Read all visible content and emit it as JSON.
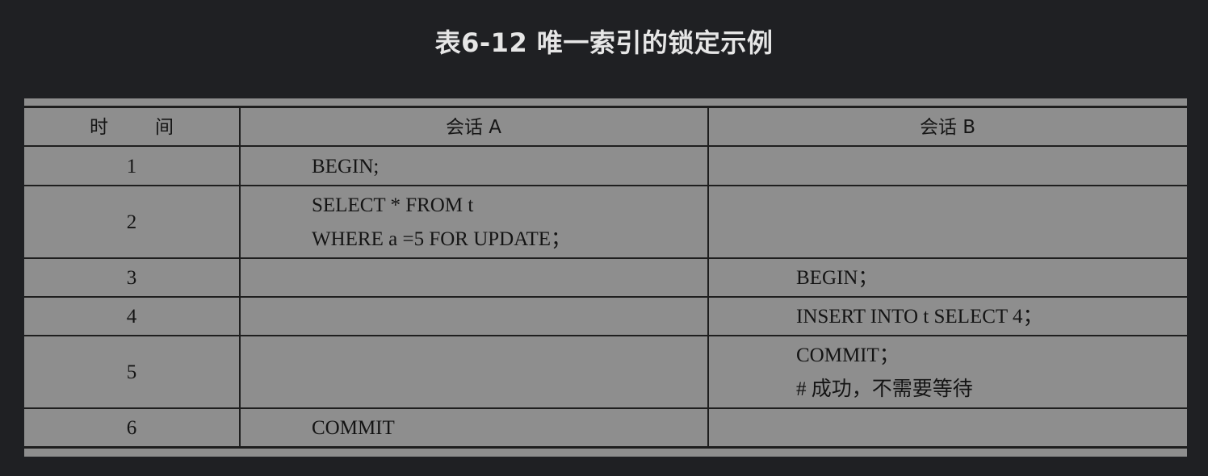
{
  "caption": "表6-12 唯一索引的锁定示例",
  "table": {
    "headers": {
      "time_left": "时",
      "time_right": "间",
      "session_a": "会话 A",
      "session_b": "会话 B"
    },
    "rows": [
      {
        "time": "1",
        "session_a": [
          "BEGIN;"
        ],
        "session_b": []
      },
      {
        "time": "2",
        "session_a": [
          "SELECT * FROM t",
          "WHERE a =5 FOR UPDATE；"
        ],
        "session_b": []
      },
      {
        "time": "3",
        "session_a": [],
        "session_b": [
          "BEGIN；"
        ]
      },
      {
        "time": "4",
        "session_a": [],
        "session_b": [
          "INSERT INTO t SELECT 4；"
        ]
      },
      {
        "time": "5",
        "session_a": [],
        "session_b": [
          "COMMIT；",
          "# 成功，不需要等待"
        ]
      },
      {
        "time": "6",
        "session_a": [
          "COMMIT"
        ],
        "session_b": []
      }
    ]
  }
}
